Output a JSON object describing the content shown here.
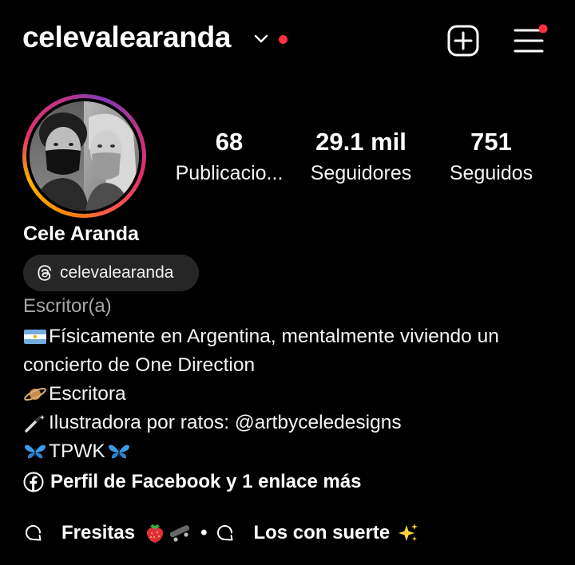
{
  "header": {
    "username": "celevalearanda",
    "icons": {
      "dropdown": "chevron-down-icon",
      "notification": "red-dot",
      "create": "plus-square-icon",
      "menu": "hamburger-menu-icon"
    },
    "notification_color": "#ff3040"
  },
  "profile": {
    "avatar_icon": "profile-photo",
    "ring_colors": [
      "#ff8a00",
      "#e1306c",
      "#833ab4"
    ],
    "stats": [
      {
        "value": "68",
        "label": "Publicacio..."
      },
      {
        "value": "29.1 mil",
        "label": "Seguidores"
      },
      {
        "value": "751",
        "label": "Seguidos"
      }
    ],
    "full_name": "Cele Aranda",
    "threads_handle": "celevalearanda",
    "category": "Escritor(a)"
  },
  "bio": {
    "lines": [
      {
        "emoji": "argentina-flag",
        "text": "Físicamente en Argentina, mentalmente viviendo un"
      },
      {
        "emoji": "",
        "text": "concierto de One Direction"
      },
      {
        "emoji": "saturn",
        "text": "Escritora"
      },
      {
        "emoji": "magic-wand",
        "text": "Ilustradora por ratos: @artbyceledesigns"
      },
      {
        "emoji": "butterfly",
        "text": "TPWK",
        "emoji_after": "butterfly"
      }
    ]
  },
  "links": {
    "text": "Perfil de Facebook y 1 enlace más",
    "icon": "facebook-icon"
  },
  "highlights": {
    "items": [
      {
        "label": "Fresitas",
        "emojis": [
          "strawberry",
          "skateboard"
        ]
      },
      {
        "label": "Los con suerte",
        "emojis": [
          "sparkles"
        ]
      }
    ],
    "separator": "•"
  }
}
